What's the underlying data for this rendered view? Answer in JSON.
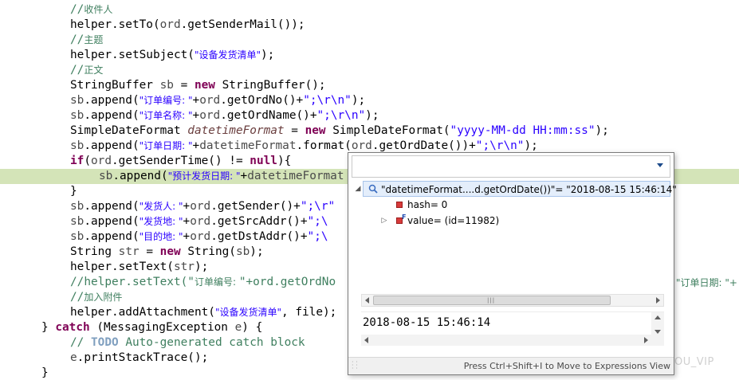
{
  "editor": {
    "lines": [
      [
        {
          "c": "c-comment",
          "t": "//"
        },
        {
          "c": "c-comment cjk",
          "t": "收件人"
        }
      ],
      [
        {
          "c": "",
          "t": "helper.setTo("
        },
        {
          "c": "c-gray",
          "t": "ord"
        },
        {
          "c": "",
          "t": ".getSenderMail());"
        }
      ],
      [
        {
          "c": "c-comment",
          "t": "//"
        },
        {
          "c": "c-comment cjk",
          "t": "主题"
        }
      ],
      [
        {
          "c": "",
          "t": "helper.setSubject("
        },
        {
          "c": "c-str cjk",
          "t": "\"设备发货清单\""
        },
        {
          "c": "",
          "t": ");"
        }
      ],
      [
        {
          "c": "c-comment",
          "t": "//"
        },
        {
          "c": "c-comment cjk",
          "t": "正文"
        }
      ],
      [
        {
          "c": "",
          "t": "StringBuffer "
        },
        {
          "c": "c-gray",
          "t": "sb"
        },
        {
          "c": "",
          "t": " = "
        },
        {
          "c": "c-kw",
          "t": "new"
        },
        {
          "c": "",
          "t": " StringBuffer();"
        }
      ],
      [
        {
          "c": "c-gray",
          "t": "sb"
        },
        {
          "c": "",
          "t": ".append("
        },
        {
          "c": "c-str cjk",
          "t": "\"订单编号: \""
        },
        {
          "c": "",
          "t": "+"
        },
        {
          "c": "c-gray",
          "t": "ord"
        },
        {
          "c": "",
          "t": ".getOrdNo()+"
        },
        {
          "c": "c-str",
          "t": "\";\\r\\n\""
        },
        {
          "c": "",
          "t": ");"
        }
      ],
      [
        {
          "c": "c-gray",
          "t": "sb"
        },
        {
          "c": "",
          "t": ".append("
        },
        {
          "c": "c-str cjk",
          "t": "\"订单名称: \""
        },
        {
          "c": "",
          "t": "+"
        },
        {
          "c": "c-gray",
          "t": "ord"
        },
        {
          "c": "",
          "t": ".getOrdName()+"
        },
        {
          "c": "c-str",
          "t": "\";\\r\\n\""
        },
        {
          "c": "",
          "t": ");"
        }
      ],
      [
        {
          "c": "",
          "t": "SimpleDateFormat "
        },
        {
          "c": "c-var",
          "t": "datetimeFormat"
        },
        {
          "c": "",
          "t": " = "
        },
        {
          "c": "c-kw",
          "t": "new"
        },
        {
          "c": "",
          "t": " SimpleDateFormat("
        },
        {
          "c": "c-str",
          "t": "\"yyyy-MM-dd HH:mm:ss\""
        },
        {
          "c": "",
          "t": ");"
        }
      ],
      [
        {
          "c": "c-gray",
          "t": "sb"
        },
        {
          "c": "",
          "t": ".append("
        },
        {
          "c": "c-str cjk",
          "t": "\"订单日期: \""
        },
        {
          "c": "",
          "t": "+"
        },
        {
          "c": "c-gray",
          "t": "datetimeFormat"
        },
        {
          "c": "",
          "t": ".format("
        },
        {
          "c": "c-gray",
          "t": "ord"
        },
        {
          "c": "",
          "t": ".getOrdDate())+"
        },
        {
          "c": "c-str",
          "t": "\";\\r\\n\""
        },
        {
          "c": "",
          "t": ");"
        }
      ],
      [
        {
          "c": "c-kw",
          "t": "if"
        },
        {
          "c": "",
          "t": "("
        },
        {
          "c": "c-gray",
          "t": "ord"
        },
        {
          "c": "",
          "t": ".getSenderTime() != "
        },
        {
          "c": "c-kw",
          "t": "null"
        },
        {
          "c": "",
          "t": "){"
        }
      ],
      [
        {
          "c": "c-gray",
          "t": "sb"
        },
        {
          "c": "",
          "t": ".append("
        },
        {
          "c": "c-str cjk",
          "t": "\"预计发货日期: \""
        },
        {
          "c": "",
          "t": "+"
        },
        {
          "c": "c-gray",
          "t": "datetimeFormat"
        }
      ],
      [
        {
          "c": "",
          "t": "}"
        }
      ],
      [
        {
          "c": "c-gray",
          "t": "sb"
        },
        {
          "c": "",
          "t": ".append("
        },
        {
          "c": "c-str cjk",
          "t": "\"发货人: \""
        },
        {
          "c": "",
          "t": "+"
        },
        {
          "c": "c-gray",
          "t": "ord"
        },
        {
          "c": "",
          "t": ".getSender()+"
        },
        {
          "c": "c-str",
          "t": "\";\\r\""
        }
      ],
      [
        {
          "c": "c-gray",
          "t": "sb"
        },
        {
          "c": "",
          "t": ".append("
        },
        {
          "c": "c-str cjk",
          "t": "\"发货地: \""
        },
        {
          "c": "",
          "t": "+"
        },
        {
          "c": "c-gray",
          "t": "ord"
        },
        {
          "c": "",
          "t": ".getSrcAddr()+"
        },
        {
          "c": "c-str",
          "t": "\";\\"
        }
      ],
      [
        {
          "c": "c-gray",
          "t": "sb"
        },
        {
          "c": "",
          "t": ".append("
        },
        {
          "c": "c-str cjk",
          "t": "\"目的地: \""
        },
        {
          "c": "",
          "t": "+"
        },
        {
          "c": "c-gray",
          "t": "ord"
        },
        {
          "c": "",
          "t": ".getDstAddr()+"
        },
        {
          "c": "c-str",
          "t": "\";\\"
        }
      ],
      [
        {
          "c": "",
          "t": "String "
        },
        {
          "c": "c-gray",
          "t": "str"
        },
        {
          "c": "",
          "t": " = "
        },
        {
          "c": "c-kw",
          "t": "new"
        },
        {
          "c": "",
          "t": " String("
        },
        {
          "c": "c-gray",
          "t": "sb"
        },
        {
          "c": "",
          "t": ");"
        }
      ],
      [
        {
          "c": "",
          "t": "helper.setText("
        },
        {
          "c": "c-gray",
          "t": "str"
        },
        {
          "c": "",
          "t": ");"
        }
      ],
      [
        {
          "c": "c-comment",
          "t": "//helper.setText(\""
        },
        {
          "c": "c-comment cjk",
          "t": "订单编号: "
        },
        {
          "c": "c-comment",
          "t": "\"+ord.getOrdNo"
        }
      ],
      [
        {
          "c": "c-comment",
          "t": "//"
        },
        {
          "c": "c-comment cjk",
          "t": "加入附件"
        }
      ],
      [
        {
          "c": "",
          "t": "helper.addAttachment("
        },
        {
          "c": "c-str cjk",
          "t": "\"设备发货清单\""
        },
        {
          "c": "",
          "t": ", file);"
        }
      ],
      [
        {
          "c": "",
          "t": "} "
        },
        {
          "c": "c-kw",
          "t": "catch"
        },
        {
          "c": "",
          "t": " (MessagingException "
        },
        {
          "c": "c-gray",
          "t": "e"
        },
        {
          "c": "",
          "t": ") {"
        }
      ],
      [
        {
          "c": "c-comment",
          "t": "// "
        },
        {
          "c": "c-todo",
          "t": "TODO"
        },
        {
          "c": "c-comment",
          "t": " Auto-generated catch block"
        }
      ],
      [
        {
          "c": "c-gray",
          "t": "e"
        },
        {
          "c": "",
          "t": ".printStackTrace();"
        }
      ],
      [
        {
          "c": "",
          "t": "}"
        }
      ]
    ],
    "overflow_text": "\"订单日期: \"+",
    "watermark": "OU_VIP"
  },
  "popup": {
    "expression_label": "\"datetimeFormat....d.getOrdDate())\"= \"2018-08-15 15:46:14\"",
    "children": [
      {
        "label": "hash= 0",
        "icon": "private-field-icon"
      },
      {
        "label": "value= (id=11982)",
        "icon": "final-field-icon"
      }
    ],
    "detail_value": "2018-08-15 15:46:14",
    "footer": "Press Ctrl+Shift+I to Move to Expressions View"
  }
}
